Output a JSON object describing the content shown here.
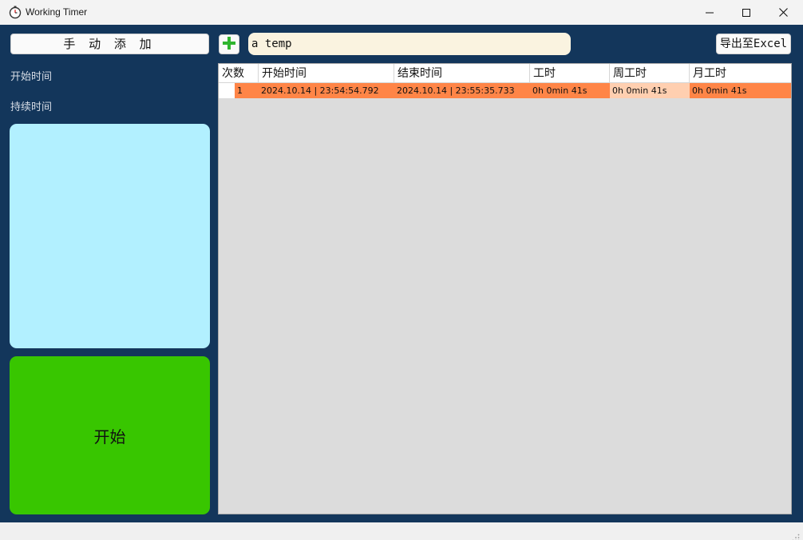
{
  "window": {
    "title": "Working Timer"
  },
  "toolbar": {
    "manual_add_label": "手 动 添 加",
    "task_value": "a temp",
    "export_label": "导出至Excel"
  },
  "left": {
    "start_time_label": "开始时间",
    "duration_label": "持续时间",
    "start_button_label": "开始"
  },
  "table": {
    "columns": [
      "次数",
      "开始时间",
      "结束时间",
      "工时",
      "周工时",
      "月工时"
    ],
    "rows": [
      {
        "index": "1",
        "start": "2024.10.14 | 23:54:54.792",
        "end": "2024.10.14 | 23:55:35.733",
        "hours": "0h 0min 41s",
        "week_hours": "0h 0min 41s",
        "month_hours": "0h 0min 41s"
      }
    ]
  },
  "colors": {
    "background": "#13365b",
    "display_panel": "#b2f0ff",
    "start_button": "#38c600",
    "row_highlight": "#ff8547",
    "row_light": "#ffcfb0",
    "input_bg": "#faf3e0",
    "plus_icon": "#2fb52f"
  },
  "icons": {
    "app": "stopwatch-icon",
    "add": "plus-icon",
    "minimize": "minimize-icon",
    "maximize": "maximize-icon",
    "close": "close-icon",
    "resize": "resize-grip-icon"
  }
}
